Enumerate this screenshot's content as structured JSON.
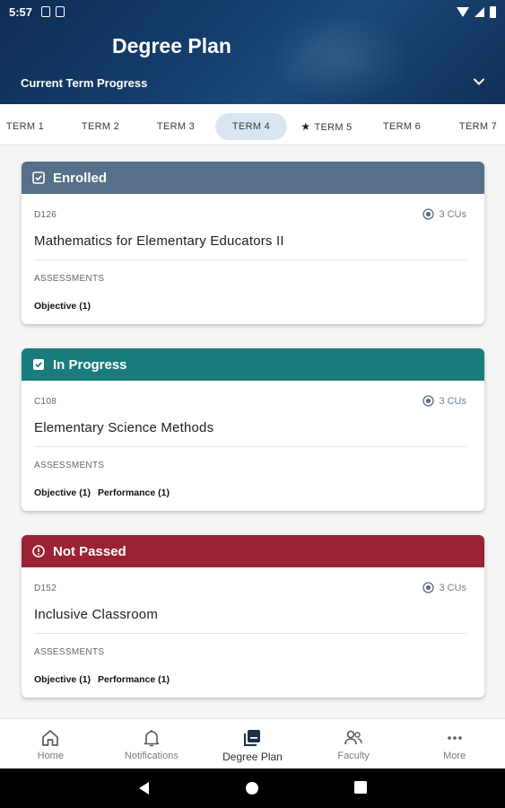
{
  "status_bar": {
    "time": "5:57"
  },
  "header": {
    "title": "Degree Plan",
    "current_term_progress": "Current Term Progress"
  },
  "tabs": [
    {
      "label": "TERM 1",
      "active": false,
      "starred": false
    },
    {
      "label": "TERM 2",
      "active": false,
      "starred": false
    },
    {
      "label": "TERM 3",
      "active": false,
      "starred": false
    },
    {
      "label": "TERM 4",
      "active": true,
      "starred": false
    },
    {
      "label": "TERM 5",
      "active": false,
      "starred": true
    },
    {
      "label": "TERM 6",
      "active": false,
      "starred": false
    },
    {
      "label": "TERM 7",
      "active": false,
      "starred": false
    }
  ],
  "courses": [
    {
      "status": "Enrolled",
      "status_color": "#57708a",
      "code": "D126",
      "cus": "3 CUs",
      "title": "Mathematics for Elementary Educators II",
      "assessments_label": "ASSESSMENTS",
      "assessments": [
        "Objective (1)"
      ]
    },
    {
      "status": "In Progress",
      "status_color": "#1a7c7c",
      "code": "C108",
      "cus": "3 CUs",
      "title": "Elementary Science Methods",
      "assessments_label": "ASSESSMENTS",
      "assessments": [
        "Objective (1)",
        "Performance (1)"
      ]
    },
    {
      "status": "Not Passed",
      "status_color": "#9b2232",
      "code": "D152",
      "cus": "3 CUs",
      "title": "Inclusive Classroom",
      "assessments_label": "ASSESSMENTS",
      "assessments": [
        "Objective (1)",
        "Performance (1)"
      ]
    }
  ],
  "bottom_nav": [
    {
      "label": "Home",
      "icon": "home-icon",
      "active": false
    },
    {
      "label": "Notifications",
      "icon": "bell-icon",
      "active": false
    },
    {
      "label": "Degree Plan",
      "icon": "degree-plan-icon",
      "active": true
    },
    {
      "label": "Faculty",
      "icon": "faculty-icon",
      "active": false
    },
    {
      "label": "More",
      "icon": "more-icon",
      "active": false
    }
  ]
}
